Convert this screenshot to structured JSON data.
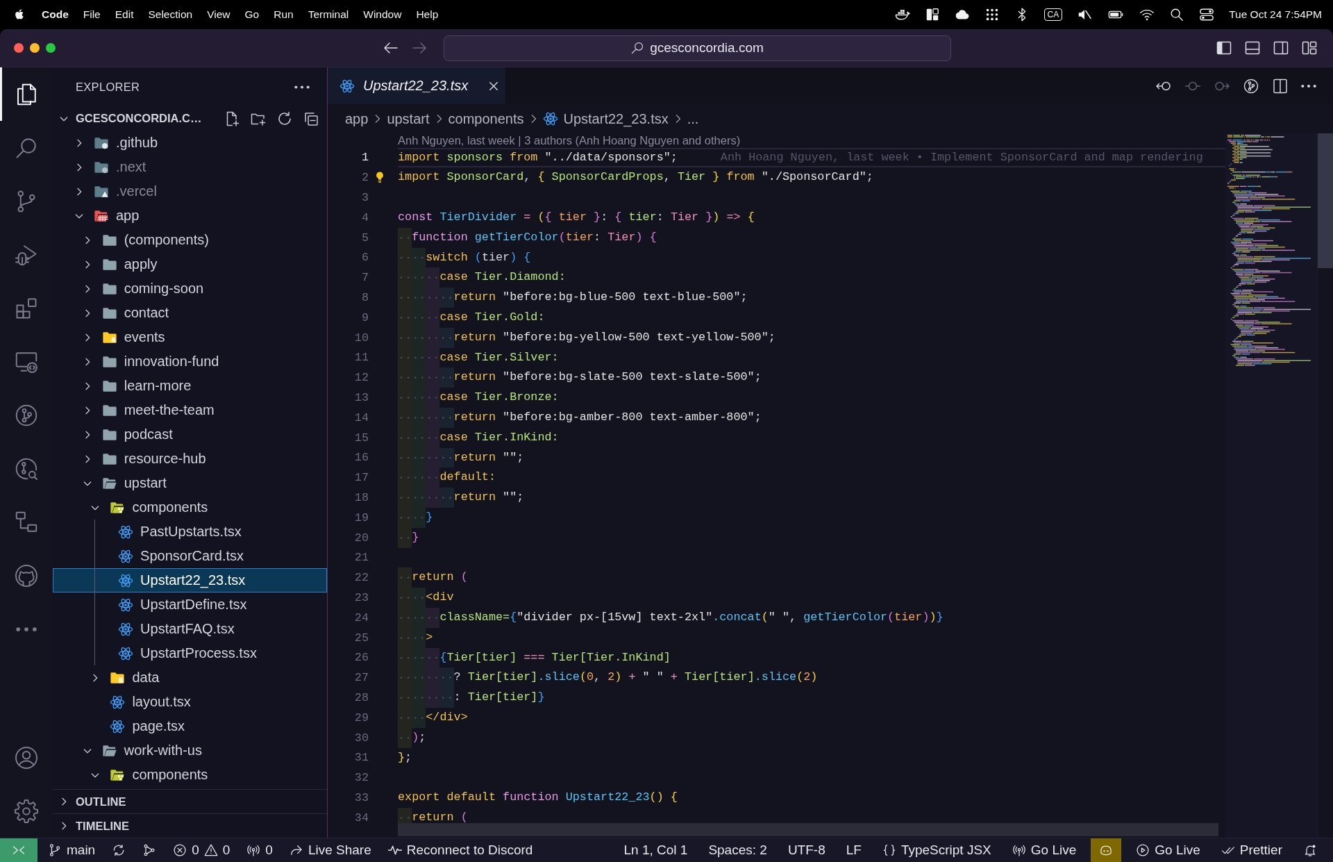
{
  "menu_bar": {
    "app_name": "Code",
    "menus": [
      "File",
      "Edit",
      "Selection",
      "View",
      "Go",
      "Run",
      "Terminal",
      "Window",
      "Help"
    ],
    "input_source": "CA",
    "clock": "Tue Oct 24 7:54PM"
  },
  "title_bar": {
    "navigation": [
      {
        "kind": "back",
        "disabled": false
      },
      {
        "kind": "forward",
        "disabled": true
      }
    ],
    "command_center": "gcesconcordia.com",
    "layout_toggles": [
      {
        "kind": "sidebar",
        "on": true
      },
      {
        "kind": "panel",
        "on": false
      },
      {
        "kind": "secondary",
        "on": false
      },
      {
        "kind": "customize"
      }
    ]
  },
  "activity_bar": {
    "items": [
      {
        "kind": "files",
        "selected": true
      },
      {
        "kind": "search",
        "selected": false
      },
      {
        "kind": "branch",
        "selected": false
      },
      {
        "kind": "debug",
        "selected": false
      },
      {
        "kind": "extensions",
        "selected": false
      },
      {
        "kind": "remote",
        "selected": false
      },
      {
        "kind": "gitlens",
        "selected": false
      },
      {
        "kind": "inspect",
        "selected": false
      },
      {
        "kind": "hierarchy",
        "selected": false
      },
      {
        "kind": "github",
        "selected": false
      },
      {
        "kind": "more",
        "selected": false
      }
    ],
    "bottom_items": [
      {
        "kind": "account"
      },
      {
        "kind": "settings"
      }
    ]
  },
  "sidebar": {
    "title": "EXPLORER",
    "workspace": {
      "label": "GCESCONCORDIA.C…",
      "expanded": true,
      "children": [
        {
          "label": ".github",
          "kind": "github",
          "expanded": false,
          "selected": false,
          "dimmed": false
        },
        {
          "label": ".next",
          "kind": "next",
          "expanded": false,
          "selected": false,
          "dimmed": true
        },
        {
          "label": ".vercel",
          "kind": "vercel",
          "expanded": false,
          "selected": false,
          "dimmed": true
        },
        {
          "label": "app",
          "kind": "app",
          "expanded": true,
          "selected": false,
          "dimmed": false,
          "children": [
            {
              "label": "(components)",
              "kind": "folder",
              "expanded": false,
              "selected": false,
              "dimmed": false
            },
            {
              "label": "apply",
              "kind": "folder",
              "expanded": false,
              "selected": false,
              "dimmed": false
            },
            {
              "label": "coming-soon",
              "kind": "folder",
              "expanded": false,
              "selected": false,
              "dimmed": false
            },
            {
              "label": "contact",
              "kind": "folder",
              "expanded": false,
              "selected": false,
              "dimmed": false
            },
            {
              "label": "events",
              "kind": "events",
              "expanded": false,
              "selected": false,
              "dimmed": false
            },
            {
              "label": "innovation-fund",
              "kind": "folder",
              "expanded": false,
              "selected": false,
              "dimmed": false
            },
            {
              "label": "learn-more",
              "kind": "folder",
              "expanded": false,
              "selected": false,
              "dimmed": false
            },
            {
              "label": "meet-the-team",
              "kind": "folder",
              "expanded": false,
              "selected": false,
              "dimmed": false
            },
            {
              "label": "podcast",
              "kind": "folder",
              "expanded": false,
              "selected": false,
              "dimmed": false
            },
            {
              "label": "resource-hub",
              "kind": "folder",
              "expanded": false,
              "selected": false,
              "dimmed": false
            },
            {
              "label": "upstart",
              "kind": "folder",
              "expanded": true,
              "selected": false,
              "dimmed": false,
              "children": [
                {
                  "label": "components",
                  "kind": "components",
                  "expanded": true,
                  "selected": false,
                  "dimmed": false,
                  "children": [
                    {
                      "label": "PastUpstarts.tsx",
                      "kind": "react",
                      "selected": false,
                      "dimmed": false
                    },
                    {
                      "label": "SponsorCard.tsx",
                      "kind": "react",
                      "selected": false,
                      "dimmed": false
                    },
                    {
                      "label": "Upstart22_23.tsx",
                      "kind": "react",
                      "selected": true,
                      "dimmed": false
                    },
                    {
                      "label": "UpstartDefine.tsx",
                      "kind": "react",
                      "selected": false,
                      "dimmed": false
                    },
                    {
                      "label": "UpstartFAQ.tsx",
                      "kind": "react",
                      "selected": false,
                      "dimmed": false
                    },
                    {
                      "label": "UpstartProcess.tsx",
                      "kind": "react",
                      "selected": false,
                      "dimmed": false
                    }
                  ]
                },
                {
                  "label": "data",
                  "kind": "data",
                  "expanded": false,
                  "selected": false,
                  "dimmed": false
                },
                {
                  "label": "layout.tsx",
                  "kind": "react",
                  "selected": false,
                  "dimmed": false
                },
                {
                  "label": "page.tsx",
                  "kind": "react",
                  "selected": false,
                  "dimmed": false
                }
              ]
            },
            {
              "label": "work-with-us",
              "kind": "folder",
              "expanded": true,
              "selected": false,
              "dimmed": false,
              "children": [
                {
                  "label": "components",
                  "kind": "components",
                  "expanded": true,
                  "selected": false,
                  "dimmed": false
                }
              ]
            }
          ]
        }
      ]
    },
    "sections": [
      {
        "label": "OUTLINE",
        "expanded": false
      },
      {
        "label": "TIMELINE",
        "expanded": false
      }
    ]
  },
  "editor": {
    "tabs": [
      {
        "label": "Upstart22_23.tsx",
        "selected": true,
        "preview": true
      }
    ],
    "actions": [
      {
        "kind": "previous",
        "disabled": false
      },
      {
        "kind": "current",
        "disabled": true
      },
      {
        "kind": "next",
        "disabled": true
      },
      {
        "kind": "gitlens",
        "disabled": false
      },
      {
        "kind": "split",
        "disabled": false
      },
      {
        "kind": "more",
        "disabled": false
      }
    ],
    "breadcrumbs": [
      {
        "label": "app",
        "kind": "folder"
      },
      {
        "label": "upstart",
        "kind": "folder"
      },
      {
        "label": "components",
        "kind": "folder"
      },
      {
        "label": "Upstart22_23.tsx",
        "kind": "react"
      },
      {
        "label": "...",
        "kind": "more"
      }
    ],
    "codelens": "Anh Nguyen, last week | 3 authors (Anh Hoang Nguyen and others)",
    "lines": [
      {
        "number": "1",
        "current": true,
        "lightbulb": false,
        "blame": "Anh Hoang Nguyen, last week • Implement SponsorCard and map rendering",
        "tokens": [
          {
            "text": "import ",
            "kind": "keyword"
          },
          {
            "text": "sponsors ",
            "kind": "variable"
          },
          {
            "text": "from ",
            "kind": "keyword"
          },
          {
            "text": "\"../data/sponsors\"",
            "kind": "string"
          },
          {
            "text": ";",
            "kind": "text"
          }
        ]
      },
      {
        "number": "2",
        "current": false,
        "lightbulb": true,
        "tokens": [
          {
            "text": "import ",
            "kind": "keyword"
          },
          {
            "text": "SponsorCard",
            "kind": "variable"
          },
          {
            "text": ", ",
            "kind": "text"
          },
          {
            "text": "{ ",
            "kind": "bracket1"
          },
          {
            "text": "SponsorCardProps",
            "kind": "variable"
          },
          {
            "text": ", ",
            "kind": "text"
          },
          {
            "text": "Tier ",
            "kind": "variable"
          },
          {
            "text": "} ",
            "kind": "bracket1"
          },
          {
            "text": "from ",
            "kind": "keyword"
          },
          {
            "text": "\"./SponsorCard\"",
            "kind": "string"
          },
          {
            "text": ";",
            "kind": "text"
          }
        ]
      },
      {
        "number": "3",
        "current": false,
        "lightbulb": false
      },
      {
        "number": "4",
        "current": false,
        "lightbulb": false,
        "tokens": [
          {
            "text": "const ",
            "kind": "storage"
          },
          {
            "text": "TierDivider ",
            "kind": "function"
          },
          {
            "text": "= ",
            "kind": "operator"
          },
          {
            "text": "(",
            "kind": "bracket1"
          },
          {
            "text": "{ ",
            "kind": "bracket2"
          },
          {
            "text": "tier ",
            "kind": "parameter"
          },
          {
            "text": "}",
            "kind": "bracket2"
          },
          {
            "text": ": ",
            "kind": "text"
          },
          {
            "text": "{ ",
            "kind": "bracket2"
          },
          {
            "text": "tier",
            "kind": "variable"
          },
          {
            "text": ": ",
            "kind": "text"
          },
          {
            "text": "Tier ",
            "kind": "type"
          },
          {
            "text": "}",
            "kind": "bracket2"
          },
          {
            "text": ")",
            "kind": "bracket1"
          },
          {
            "text": " => ",
            "kind": "operator"
          },
          {
            "text": "{",
            "kind": "bracket1"
          }
        ]
      },
      {
        "number": "5",
        "current": false,
        "lightbulb": false,
        "tokens": [
          {
            "text": "  function ",
            "kind": "storage"
          },
          {
            "text": "getTierColor",
            "kind": "function"
          },
          {
            "text": "(",
            "kind": "bracket2"
          },
          {
            "text": "tier",
            "kind": "parameter"
          },
          {
            "text": ": ",
            "kind": "text"
          },
          {
            "text": "Tier",
            "kind": "type"
          },
          {
            "text": ") {",
            "kind": "bracket2"
          }
        ]
      },
      {
        "number": "6",
        "current": false,
        "lightbulb": false,
        "tokens": [
          {
            "text": "    switch ",
            "kind": "keyword"
          },
          {
            "text": "(",
            "kind": "bracket3"
          },
          {
            "text": "tier",
            "kind": "text"
          },
          {
            "text": ") {",
            "kind": "bracket3"
          }
        ]
      },
      {
        "number": "7",
        "current": false,
        "lightbulb": false,
        "tokens": [
          {
            "text": "      case ",
            "kind": "keyword"
          },
          {
            "text": "Tier.Diamond:",
            "kind": "variable"
          }
        ]
      },
      {
        "number": "8",
        "current": false,
        "lightbulb": false,
        "tokens": [
          {
            "text": "        return ",
            "kind": "keyword"
          },
          {
            "text": "\"before:bg-blue-500 text-blue-500\"",
            "kind": "string"
          },
          {
            "text": ";",
            "kind": "text"
          }
        ]
      },
      {
        "number": "9",
        "current": false,
        "lightbulb": false,
        "tokens": [
          {
            "text": "      case ",
            "kind": "keyword"
          },
          {
            "text": "Tier.Gold:",
            "kind": "variable"
          }
        ]
      },
      {
        "number": "10",
        "current": false,
        "lightbulb": false,
        "tokens": [
          {
            "text": "        return ",
            "kind": "keyword"
          },
          {
            "text": "\"before:bg-yellow-500 text-yellow-500\"",
            "kind": "string"
          },
          {
            "text": ";",
            "kind": "text"
          }
        ]
      },
      {
        "number": "11",
        "current": false,
        "lightbulb": false,
        "tokens": [
          {
            "text": "      case ",
            "kind": "keyword"
          },
          {
            "text": "Tier.Silver:",
            "kind": "variable"
          }
        ]
      },
      {
        "number": "12",
        "current": false,
        "lightbulb": false,
        "tokens": [
          {
            "text": "        return ",
            "kind": "keyword"
          },
          {
            "text": "\"before:bg-slate-500 text-slate-500\"",
            "kind": "string"
          },
          {
            "text": ";",
            "kind": "text"
          }
        ]
      },
      {
        "number": "13",
        "current": false,
        "lightbulb": false,
        "tokens": [
          {
            "text": "      case ",
            "kind": "keyword"
          },
          {
            "text": "Tier.Bronze:",
            "kind": "variable"
          }
        ]
      },
      {
        "number": "14",
        "current": false,
        "lightbulb": false,
        "tokens": [
          {
            "text": "        return ",
            "kind": "keyword"
          },
          {
            "text": "\"before:bg-amber-800 text-amber-800\"",
            "kind": "string"
          },
          {
            "text": ";",
            "kind": "text"
          }
        ]
      },
      {
        "number": "15",
        "current": false,
        "lightbulb": false,
        "tokens": [
          {
            "text": "      case ",
            "kind": "keyword"
          },
          {
            "text": "Tier.InKind:",
            "kind": "variable"
          }
        ]
      },
      {
        "number": "16",
        "current": false,
        "lightbulb": false,
        "tokens": [
          {
            "text": "        return ",
            "kind": "keyword"
          },
          {
            "text": "\"\"",
            "kind": "string"
          },
          {
            "text": ";",
            "kind": "text"
          }
        ]
      },
      {
        "number": "17",
        "current": false,
        "lightbulb": false,
        "tokens": [
          {
            "text": "      default:",
            "kind": "keyword"
          }
        ]
      },
      {
        "number": "18",
        "current": false,
        "lightbulb": false,
        "tokens": [
          {
            "text": "        return ",
            "kind": "keyword"
          },
          {
            "text": "\"\"",
            "kind": "string"
          },
          {
            "text": ";",
            "kind": "text"
          }
        ]
      },
      {
        "number": "19",
        "current": false,
        "lightbulb": false,
        "tokens": [
          {
            "text": "    }",
            "kind": "bracket3"
          }
        ]
      },
      {
        "number": "20",
        "current": false,
        "lightbulb": false,
        "tokens": [
          {
            "text": "  }",
            "kind": "bracket2"
          }
        ]
      },
      {
        "number": "21",
        "current": false,
        "lightbulb": false
      },
      {
        "number": "22",
        "current": false,
        "lightbulb": false,
        "tokens": [
          {
            "text": "  return ",
            "kind": "keyword"
          },
          {
            "text": "(",
            "kind": "bracket2"
          }
        ]
      },
      {
        "number": "23",
        "current": false,
        "lightbulb": false,
        "tokens": [
          {
            "text": "    <div",
            "kind": "tag"
          }
        ]
      },
      {
        "number": "24",
        "current": false,
        "lightbulb": false,
        "tokens": [
          {
            "text": "      className=",
            "kind": "variable"
          },
          {
            "text": "{",
            "kind": "bracket3"
          },
          {
            "text": "\"divider px-[15vw] text-2xl\"",
            "kind": "string"
          },
          {
            "text": ".concat",
            "kind": "function"
          },
          {
            "text": "(",
            "kind": "bracket1"
          },
          {
            "text": "\" \"",
            "kind": "string"
          },
          {
            "text": ", ",
            "kind": "text"
          },
          {
            "text": "getTierColor",
            "kind": "function"
          },
          {
            "text": "(",
            "kind": "bracket2"
          },
          {
            "text": "tier",
            "kind": "parameter"
          },
          {
            "text": ")",
            "kind": "bracket2"
          },
          {
            "text": ")",
            "kind": "bracket1"
          },
          {
            "text": "}",
            "kind": "bracket3"
          }
        ]
      },
      {
        "number": "25",
        "current": false,
        "lightbulb": false,
        "tokens": [
          {
            "text": "    >",
            "kind": "tag"
          }
        ]
      },
      {
        "number": "26",
        "current": false,
        "lightbulb": false,
        "tokens": [
          {
            "text": "      {",
            "kind": "bracket3"
          },
          {
            "text": "Tier[tier] ",
            "kind": "variable"
          },
          {
            "text": "=== ",
            "kind": "operator"
          },
          {
            "text": "Tier[Tier.InKind]",
            "kind": "variable"
          }
        ]
      },
      {
        "number": "27",
        "current": false,
        "lightbulb": false,
        "tokens": [
          {
            "text": "        ? ",
            "kind": "text"
          },
          {
            "text": "Tier[tier]",
            "kind": "variable"
          },
          {
            "text": ".slice",
            "kind": "function"
          },
          {
            "text": "(",
            "kind": "bracket1"
          },
          {
            "text": "0",
            "kind": "number"
          },
          {
            "text": ", ",
            "kind": "text"
          },
          {
            "text": "2",
            "kind": "number"
          },
          {
            "text": ")",
            "kind": "bracket1"
          },
          {
            "text": " + ",
            "kind": "operator"
          },
          {
            "text": "\" \"",
            "kind": "string"
          },
          {
            "text": " + ",
            "kind": "operator"
          },
          {
            "text": "Tier[tier]",
            "kind": "variable"
          },
          {
            "text": ".slice",
            "kind": "function"
          },
          {
            "text": "(",
            "kind": "bracket1"
          },
          {
            "text": "2",
            "kind": "number"
          },
          {
            "text": ")",
            "kind": "bracket1"
          }
        ]
      },
      {
        "number": "28",
        "current": false,
        "lightbulb": false,
        "tokens": [
          {
            "text": "        : ",
            "kind": "text"
          },
          {
            "text": "Tier[tier]",
            "kind": "variable"
          },
          {
            "text": "}",
            "kind": "bracket3"
          }
        ]
      },
      {
        "number": "29",
        "current": false,
        "lightbulb": false,
        "tokens": [
          {
            "text": "    </div>",
            "kind": "tag"
          }
        ]
      },
      {
        "number": "30",
        "current": false,
        "lightbulb": false,
        "tokens": [
          {
            "text": "  )",
            "kind": "bracket2"
          },
          {
            "text": ";",
            "kind": "text"
          }
        ]
      },
      {
        "number": "31",
        "current": false,
        "lightbulb": false,
        "tokens": [
          {
            "text": "}",
            "kind": "bracket1"
          },
          {
            "text": ";",
            "kind": "text"
          }
        ]
      },
      {
        "number": "32",
        "current": false,
        "lightbulb": false
      },
      {
        "number": "33",
        "current": false,
        "lightbulb": false,
        "tokens": [
          {
            "text": "export default ",
            "kind": "keyword"
          },
          {
            "text": "function ",
            "kind": "storage"
          },
          {
            "text": "Upstart22_23",
            "kind": "function"
          },
          {
            "text": "() {",
            "kind": "bracket1"
          }
        ]
      },
      {
        "number": "34",
        "current": false,
        "lightbulb": false,
        "tokens": [
          {
            "text": "  return ",
            "kind": "keyword"
          },
          {
            "text": "(",
            "kind": "bracket2"
          }
        ]
      }
    ]
  },
  "status_bar": {
    "left": [
      {
        "kind": "remote"
      },
      {
        "kind": "branch",
        "text": "main"
      },
      {
        "kind": "sync"
      },
      {
        "kind": "graph"
      },
      {
        "kind": "problems",
        "errors": "0",
        "warnings": "0"
      },
      {
        "kind": "ports",
        "text": "0"
      },
      {
        "kind": "liveshare",
        "text": "Live Share"
      },
      {
        "kind": "discord",
        "text": "Reconnect to Discord"
      }
    ],
    "right": [
      {
        "kind": "plain",
        "text": "Ln 1, Col 1"
      },
      {
        "kind": "plain",
        "text": "Spaces: 2"
      },
      {
        "kind": "plain",
        "text": "UTF-8"
      },
      {
        "kind": "plain",
        "text": "LF"
      },
      {
        "kind": "language",
        "text": "TypeScript JSX"
      },
      {
        "kind": "golive",
        "text": "Go Live"
      },
      {
        "kind": "copilot"
      },
      {
        "kind": "play",
        "text": "Go Live"
      },
      {
        "kind": "prettier",
        "text": "Prettier"
      },
      {
        "kind": "bell"
      }
    ]
  }
}
